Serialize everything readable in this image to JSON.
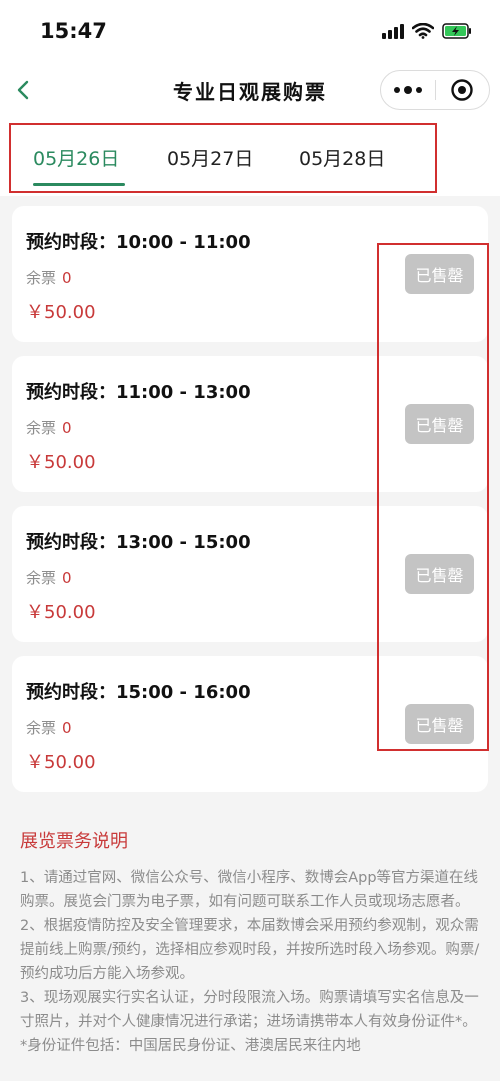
{
  "status": {
    "time": "15:47"
  },
  "nav": {
    "title": "专业日观展购票"
  },
  "date_tabs": [
    {
      "label": "05月26日",
      "active": true
    },
    {
      "label": "05月27日",
      "active": false
    },
    {
      "label": "05月28日",
      "active": false
    }
  ],
  "slots": [
    {
      "label": "预约时段：10:00 - 11:00",
      "remain_label": "余票",
      "remain": "0",
      "price": "￥50.00",
      "button": "已售罄"
    },
    {
      "label": "预约时段：11:00 - 13:00",
      "remain_label": "余票",
      "remain": "0",
      "price": "￥50.00",
      "button": "已售罄"
    },
    {
      "label": "预约时段：13:00 - 15:00",
      "remain_label": "余票",
      "remain": "0",
      "price": "￥50.00",
      "button": "已售罄"
    },
    {
      "label": "预约时段：15:00 - 16:00",
      "remain_label": "余票",
      "remain": "0",
      "price": "￥50.00",
      "button": "已售罄"
    }
  ],
  "notes": {
    "title": "展览票务说明",
    "items": [
      "1、请通过官网、微信公众号、微信小程序、数博会App等官方渠道在线购票。展览会门票为电子票，如有问题可联系工作人员或现场志愿者。",
      "2、根据疫情防控及安全管理要求，本届数博会采用预约参观制，观众需提前线上购票/预约，选择相应参观时段，并按所选时段入场参观。购票/预约成功后方能入场参观。",
      "3、现场观展实行实名认证，分时段限流入场。购票请填写实名信息及一寸照片，并对个人健康情况进行承诺；进场请携带本人有效身份证件*。*身份证件包括：中国居民身份证、港澳居民来往内地"
    ]
  },
  "colors": {
    "accent": "#2b8a5f",
    "price": "#c83a3a",
    "soldout": "#c4c4c4",
    "highlight": "#d12f2f"
  }
}
